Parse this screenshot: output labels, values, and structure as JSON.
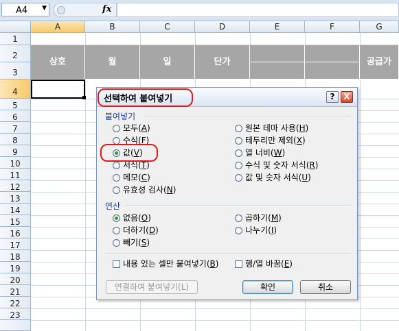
{
  "formula_bar": {
    "name_box": "A4",
    "fx_label": "fx",
    "formula": ""
  },
  "columns": [
    "A",
    "B",
    "C",
    "D",
    "E",
    "F",
    "G"
  ],
  "rows": [
    "1",
    "2",
    "3",
    "4",
    "5",
    "6",
    "7",
    "8",
    "9",
    "10",
    "11",
    "12",
    "13",
    "14",
    "15",
    "16",
    "17",
    "18",
    "19",
    "20",
    "21",
    "22",
    "23"
  ],
  "sheet": {
    "header_cells": {
      "A": "상호",
      "B": "월",
      "C": "일",
      "D": "단가",
      "G": "공급가"
    }
  },
  "dialog": {
    "title": "선택하여 붙여넣기",
    "help_btn": "?",
    "close_btn": "X",
    "paste_group": "붙여넣기",
    "paste_options_left": [
      {
        "pre": "모두(",
        "key": "A",
        "post": ")",
        "selected": false
      },
      {
        "pre": "수식(",
        "key": "F",
        "post": ")",
        "selected": false
      },
      {
        "pre": "값(",
        "key": "V",
        "post": ")",
        "selected": true
      },
      {
        "pre": "서식(",
        "key": "T",
        "post": ")",
        "selected": false
      },
      {
        "pre": "메모(",
        "key": "C",
        "post": ")",
        "selected": false
      },
      {
        "pre": "유효성 검사(",
        "key": "N",
        "post": ")",
        "selected": false
      }
    ],
    "paste_options_right": [
      {
        "pre": "원본 테마 사용(",
        "key": "H",
        "post": ")",
        "selected": false
      },
      {
        "pre": "테두리만 제외(",
        "key": "X",
        "post": ")",
        "selected": false
      },
      {
        "pre": "열 너비(",
        "key": "W",
        "post": ")",
        "selected": false
      },
      {
        "pre": "수식 및 숫자 서식(",
        "key": "R",
        "post": ")",
        "selected": false
      },
      {
        "pre": "값 및 숫자 서식(",
        "key": "U",
        "post": ")",
        "selected": false
      }
    ],
    "operation_group": "연산",
    "op_options_left": [
      {
        "pre": "없음(",
        "key": "O",
        "post": ")",
        "selected": true
      },
      {
        "pre": "더하기(",
        "key": "D",
        "post": ")",
        "selected": false
      },
      {
        "pre": "빼기(",
        "key": "S",
        "post": ")",
        "selected": false
      }
    ],
    "op_options_right": [
      {
        "pre": "곱하기(",
        "key": "M",
        "post": ")",
        "selected": false
      },
      {
        "pre": "나누기(",
        "key": "I",
        "post": ")",
        "selected": false
      }
    ],
    "skip_blanks": {
      "pre": "내용 있는 셀만 붙여넣기(",
      "key": "B",
      "post": ")",
      "checked": false
    },
    "transpose": {
      "pre": "행/열 바꿈(",
      "key": "E",
      "post": ")",
      "checked": false
    },
    "paste_link": "연결하여 붙여넣기(L)",
    "ok": "확인",
    "cancel": "취소"
  },
  "colors": {
    "annotation": "#e21818",
    "header_fill": "#a6a6a6",
    "group_label": "#1a3fa0"
  }
}
